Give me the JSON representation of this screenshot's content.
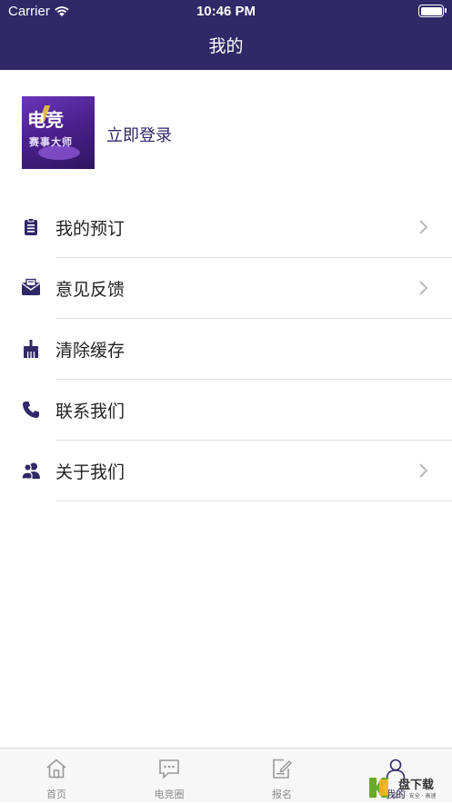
{
  "status_bar": {
    "carrier": "Carrier",
    "time": "10:46 PM"
  },
  "nav": {
    "title": "我的"
  },
  "profile": {
    "avatar_title": "电竞",
    "avatar_subtitle": "赛事大师",
    "login_label": "立即登录"
  },
  "menu": {
    "items": [
      {
        "label": "我的预订",
        "icon": "clipboard-icon",
        "has_arrow": true
      },
      {
        "label": "意见反馈",
        "icon": "mail-icon",
        "has_arrow": true
      },
      {
        "label": "清除缓存",
        "icon": "broom-icon",
        "has_arrow": false
      },
      {
        "label": "联系我们",
        "icon": "phone-icon",
        "has_arrow": false
      },
      {
        "label": "关于我们",
        "icon": "users-icon",
        "has_arrow": true
      }
    ]
  },
  "tabbar": {
    "tabs": [
      {
        "label": "首页",
        "icon": "home-icon"
      },
      {
        "label": "电竞圈",
        "icon": "chat-icon"
      },
      {
        "label": "报名",
        "icon": "edit-icon"
      },
      {
        "label": "我的",
        "icon": "user-icon",
        "active": true
      }
    ]
  },
  "watermark": {
    "brand": "盘下载",
    "slogan": "绿色 · 安全 · 高速"
  },
  "colors": {
    "primary": "#302867",
    "text": "#222222",
    "muted": "#8a8a8a",
    "divider": "#e2e2e2"
  }
}
